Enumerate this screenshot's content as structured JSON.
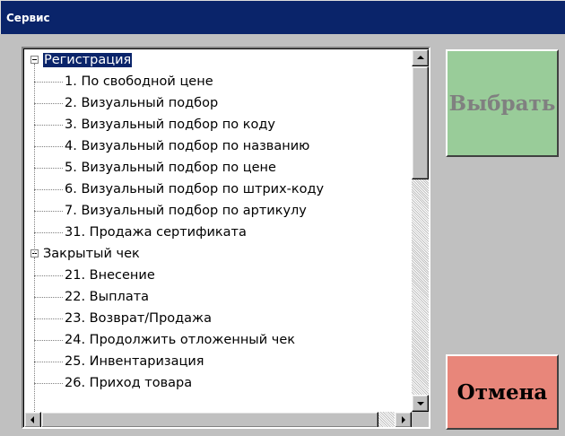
{
  "window": {
    "title": "Сервис"
  },
  "tree": {
    "groups": [
      {
        "label": "Регистрация",
        "selected": true,
        "items": [
          "1. По свободной цене",
          "2. Визуальный подбор",
          "3. Визуальный подбор по коду",
          "4. Визуальный подбор по названию",
          "5. Визуальный подбор по цене",
          "6. Визуальный подбор по штрих-коду",
          "7. Визуальный подбор по артикулу",
          "31. Продажа сертификата"
        ]
      },
      {
        "label": "Закрытый чек",
        "selected": false,
        "items": [
          "21. Внесение",
          "22. Выплата",
          "23. Возврат/Продажа",
          "24. Продолжить отложенный чек",
          "25. Инвентаризация",
          "26. Приход товара"
        ]
      }
    ]
  },
  "buttons": {
    "select_label": "Выбрать",
    "cancel_label": "Отмена"
  },
  "colors": {
    "title_bar": "#0a246a",
    "select_button": "#99cc99",
    "cancel_button": "#e8867a",
    "window_bg": "#c0c0c0"
  },
  "icons": {
    "scroll_up": "scroll-up-arrow-icon",
    "scroll_down": "scroll-down-arrow-icon",
    "scroll_left": "scroll-left-arrow-icon",
    "scroll_right": "scroll-right-arrow-icon",
    "expander": "collapse-minus-icon"
  }
}
